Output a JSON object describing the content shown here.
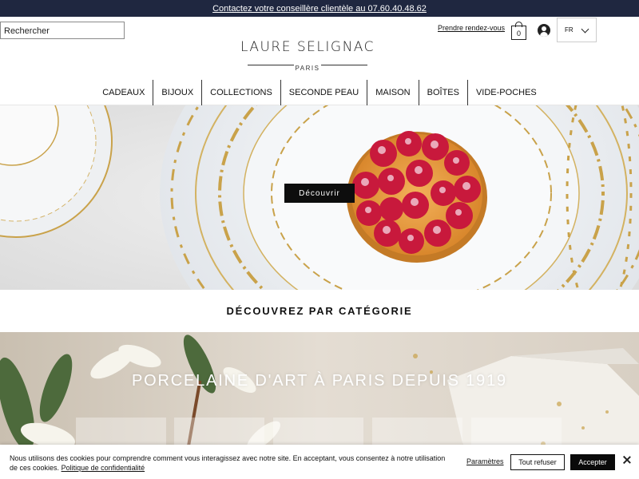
{
  "topbar": {
    "contact_link": "Contactez votre conseillère clientèle au 07.60.40.48.62"
  },
  "header": {
    "search_placeholder": "Rechercher",
    "logo_name": "LAURE SELIGNAC",
    "logo_sub": "PARIS",
    "appointment_link": "Prendre rendez-vous",
    "cart_count": "0",
    "language": "FR"
  },
  "nav": {
    "items": [
      {
        "label": "CADEAUX"
      },
      {
        "label": "BIJOUX"
      },
      {
        "label": "COLLECTIONS"
      },
      {
        "label": "SECONDE PEAU"
      },
      {
        "label": "MAISON"
      },
      {
        "label": "BOÎTES"
      },
      {
        "label": "VIDE-POCHES"
      }
    ]
  },
  "hero": {
    "button_label": "Découvrir"
  },
  "category": {
    "title": "DÉCOUVREZ PAR CATÉGORIE"
  },
  "section2": {
    "title": "PORCELAINE D'ART À PARIS DEPUIS 1919"
  },
  "cookie": {
    "text": "Nous utilisons des cookies pour comprendre comment vous interagissez avec notre site. En acceptant, vous consentez à notre utilisation de ces cookies.",
    "policy_link": "Politique de confidentialité",
    "settings_label": "Paramètres",
    "refuse_label": "Tout refuser",
    "accept_label": "Accepter"
  },
  "colors": {
    "topbar_bg": "#1f2740",
    "gold": "#c9a24a",
    "raspberry": "#c8193c",
    "button_dark": "#0d0d0d"
  }
}
